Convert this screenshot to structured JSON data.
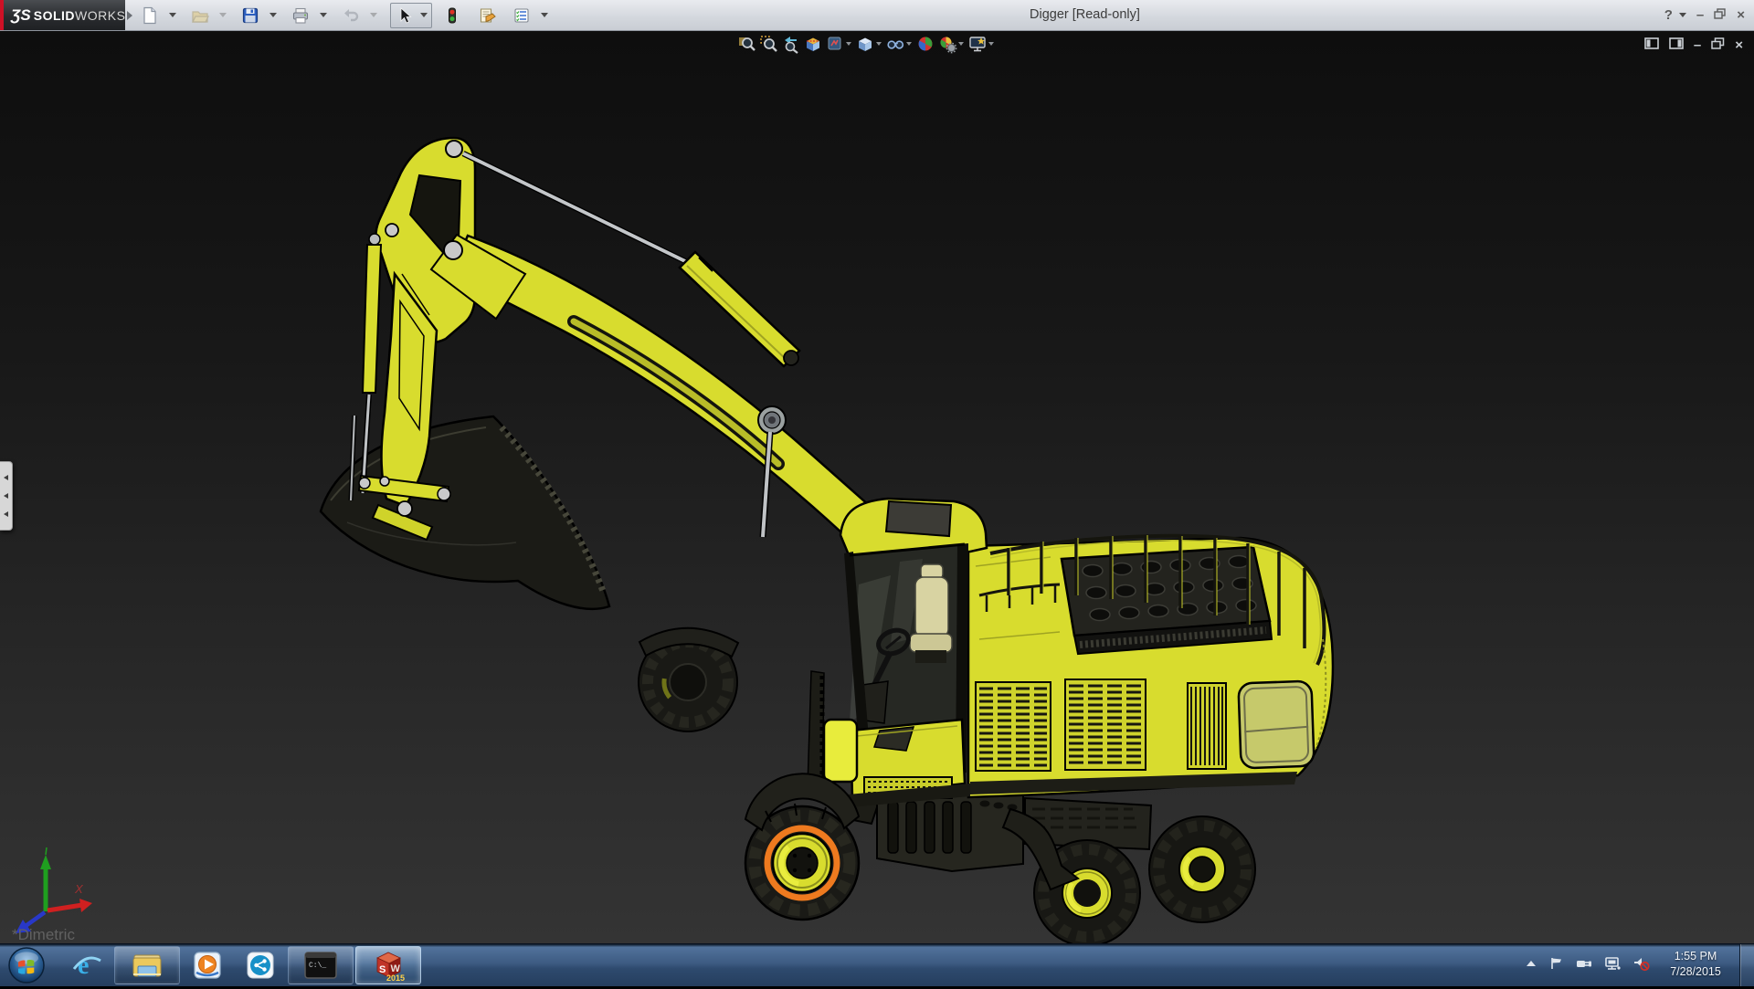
{
  "window": {
    "title": "Digger [Read-only]",
    "logo": {
      "glyph": "ƷS",
      "bold": "SOLID",
      "light": "WORKS"
    },
    "controls": {
      "help": "?",
      "minimize": "–",
      "close": "×"
    }
  },
  "main_toolbar": {
    "buttons": [
      "new-document",
      "open",
      "save",
      "print",
      "undo",
      "select",
      "rebuild",
      "file-properties",
      "options"
    ],
    "disabled": [
      "open",
      "undo"
    ],
    "pressed": [
      "select"
    ]
  },
  "heads_up_toolbar": {
    "buttons": [
      "zoom-to-fit",
      "zoom-to-area",
      "previous-view",
      "section-view",
      "display-style",
      "view-orientation",
      "hide-show-items",
      "edit-appearance",
      "apply-scene",
      "view-settings"
    ]
  },
  "document_window_controls": [
    "split-pane-left",
    "split-pane-right",
    "minimize",
    "restore",
    "close"
  ],
  "feature_panel": {
    "collapsed": true
  },
  "viewport": {
    "view_orientation_label": "*Dimetric",
    "triad": {
      "x_label": "X",
      "x_color": "#cf2020",
      "y_color": "#1f9f1f",
      "z_color": "#2838c8"
    },
    "background_top": "#0e0e0e",
    "background_bottom": "#343434",
    "selection_highlight_color": "#ee7a1f",
    "model": {
      "name": "Digger",
      "body_color": "#d8dc2e",
      "chassis_color": "#20201a",
      "cylinder_color": "#c0c3c6",
      "selected_part": "front-wheel-rim"
    }
  },
  "taskbar": {
    "start": {
      "name": "start-button"
    },
    "apps": [
      {
        "name": "internet-explorer",
        "running": false
      },
      {
        "name": "windows-explorer",
        "running": true
      },
      {
        "name": "windows-media-player",
        "running": false
      },
      {
        "name": "share-app",
        "running": false
      },
      {
        "name": "command-prompt",
        "running": true,
        "icon_text": "C:\\_"
      },
      {
        "name": "solidworks",
        "running": true,
        "active": true,
        "badge": "2015",
        "letter_s": "S",
        "letter_w": "W"
      }
    ],
    "tray": {
      "icons": [
        "hidden-icons-chevron",
        "action-center-flag",
        "power-plug",
        "network",
        "volume-muted"
      ],
      "time": "1:55 PM",
      "date": "7/28/2015"
    }
  }
}
